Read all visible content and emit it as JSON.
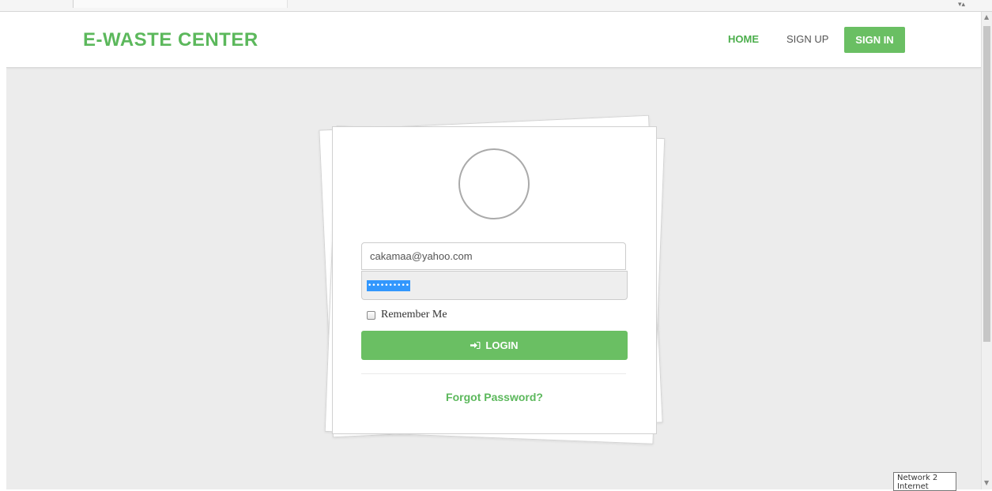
{
  "header": {
    "brand": "E-WASTE CENTER",
    "nav": {
      "home": "HOME",
      "signup": "SIGN UP",
      "signin": "SIGN IN"
    }
  },
  "login": {
    "email_value": "cakamaa@yahoo.com",
    "password_masked": "••••••••••",
    "remember_label": "Remember Me",
    "remember_checked": false,
    "login_button": "LOGIN",
    "forgot_link": "Forgot Password?"
  },
  "tooltip": {
    "line1": "Network 2",
    "line2": "Internet access"
  },
  "icons": {
    "login": "sign-in-icon",
    "avatar": "user-avatar-placeholder"
  },
  "colors": {
    "brand_green": "#5cb85c",
    "button_green": "#6abf63",
    "page_bg": "#ececec",
    "selection_blue": "#3297fd"
  }
}
